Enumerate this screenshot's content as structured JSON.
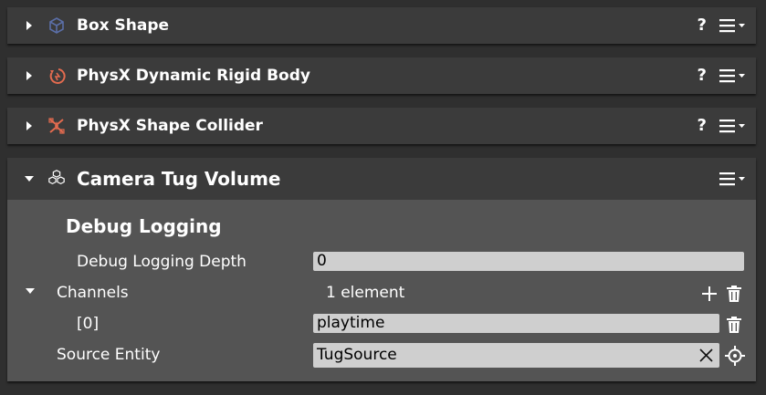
{
  "components": [
    {
      "title": "Box Shape",
      "help": "?",
      "icon": "cube-icon"
    },
    {
      "title": "PhysX Dynamic Rigid Body",
      "help": "?",
      "icon": "rigid-body-icon"
    },
    {
      "title": "PhysX Shape Collider",
      "help": "?",
      "icon": "collider-icon"
    }
  ],
  "camera_tug": {
    "title": "Camera Tug Volume",
    "icon": "cubes-icon",
    "section_title": "Debug Logging",
    "debug_depth_label": "Debug Logging Depth",
    "debug_depth_value": "0",
    "channels_label": "Channels",
    "channels_count": "1 element",
    "channel_index_label": "[0]",
    "channel_value": "playtime",
    "source_entity_label": "Source Entity",
    "source_entity_value": "TugSource"
  },
  "colors": {
    "page_bg": "#2f2f2f",
    "header_bg": "#3b3b3b",
    "body_bg": "#545454",
    "field_bg": "#cfcfcf",
    "box_icon": "#5b6fa8",
    "physx_icon": "#e36b4f"
  }
}
